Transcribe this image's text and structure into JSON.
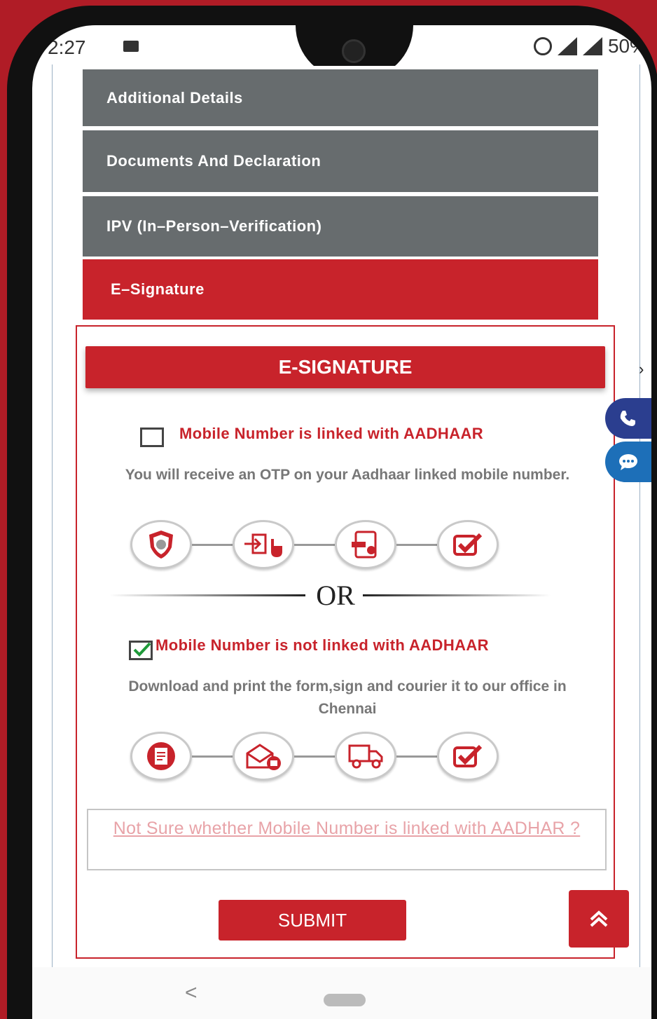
{
  "status_bar": {
    "time": "2:27",
    "battery": "50%"
  },
  "menu": {
    "items": [
      {
        "label": "Additional Details",
        "active": false
      },
      {
        "label": "Documents And Declaration",
        "active": false
      },
      {
        "label": "IPV (In–Person–Verification)",
        "active": false
      },
      {
        "label": "E–Signature",
        "active": true
      }
    ]
  },
  "esign": {
    "header": "E-SIGNATURE",
    "option_linked": {
      "label": "Mobile Number is linked with AADHAAR",
      "checked": false,
      "description": "You will receive an OTP on your Aadhaar linked mobile number.",
      "steps": [
        "shield-icon",
        "login-tap-icon",
        "otp-document-icon",
        "check-icon"
      ]
    },
    "or_text": "OR",
    "option_not_linked": {
      "label": "Mobile Number is not linked with AADHAAR",
      "checked": true,
      "description": "Download and print the form,sign and courier it to our office in Chennai",
      "steps": [
        "form-icon",
        "envelope-print-icon",
        "courier-truck-icon",
        "check-icon"
      ]
    },
    "not_sure_link": "Not Sure whether Mobile Number is linked with AADHAR ?",
    "submit_label": "SUBMIT"
  },
  "colors": {
    "accent": "#c8232b",
    "menu_grey": "#676c6e",
    "call_button": "#2b3e8f",
    "chat_button": "#1d6fb8"
  }
}
